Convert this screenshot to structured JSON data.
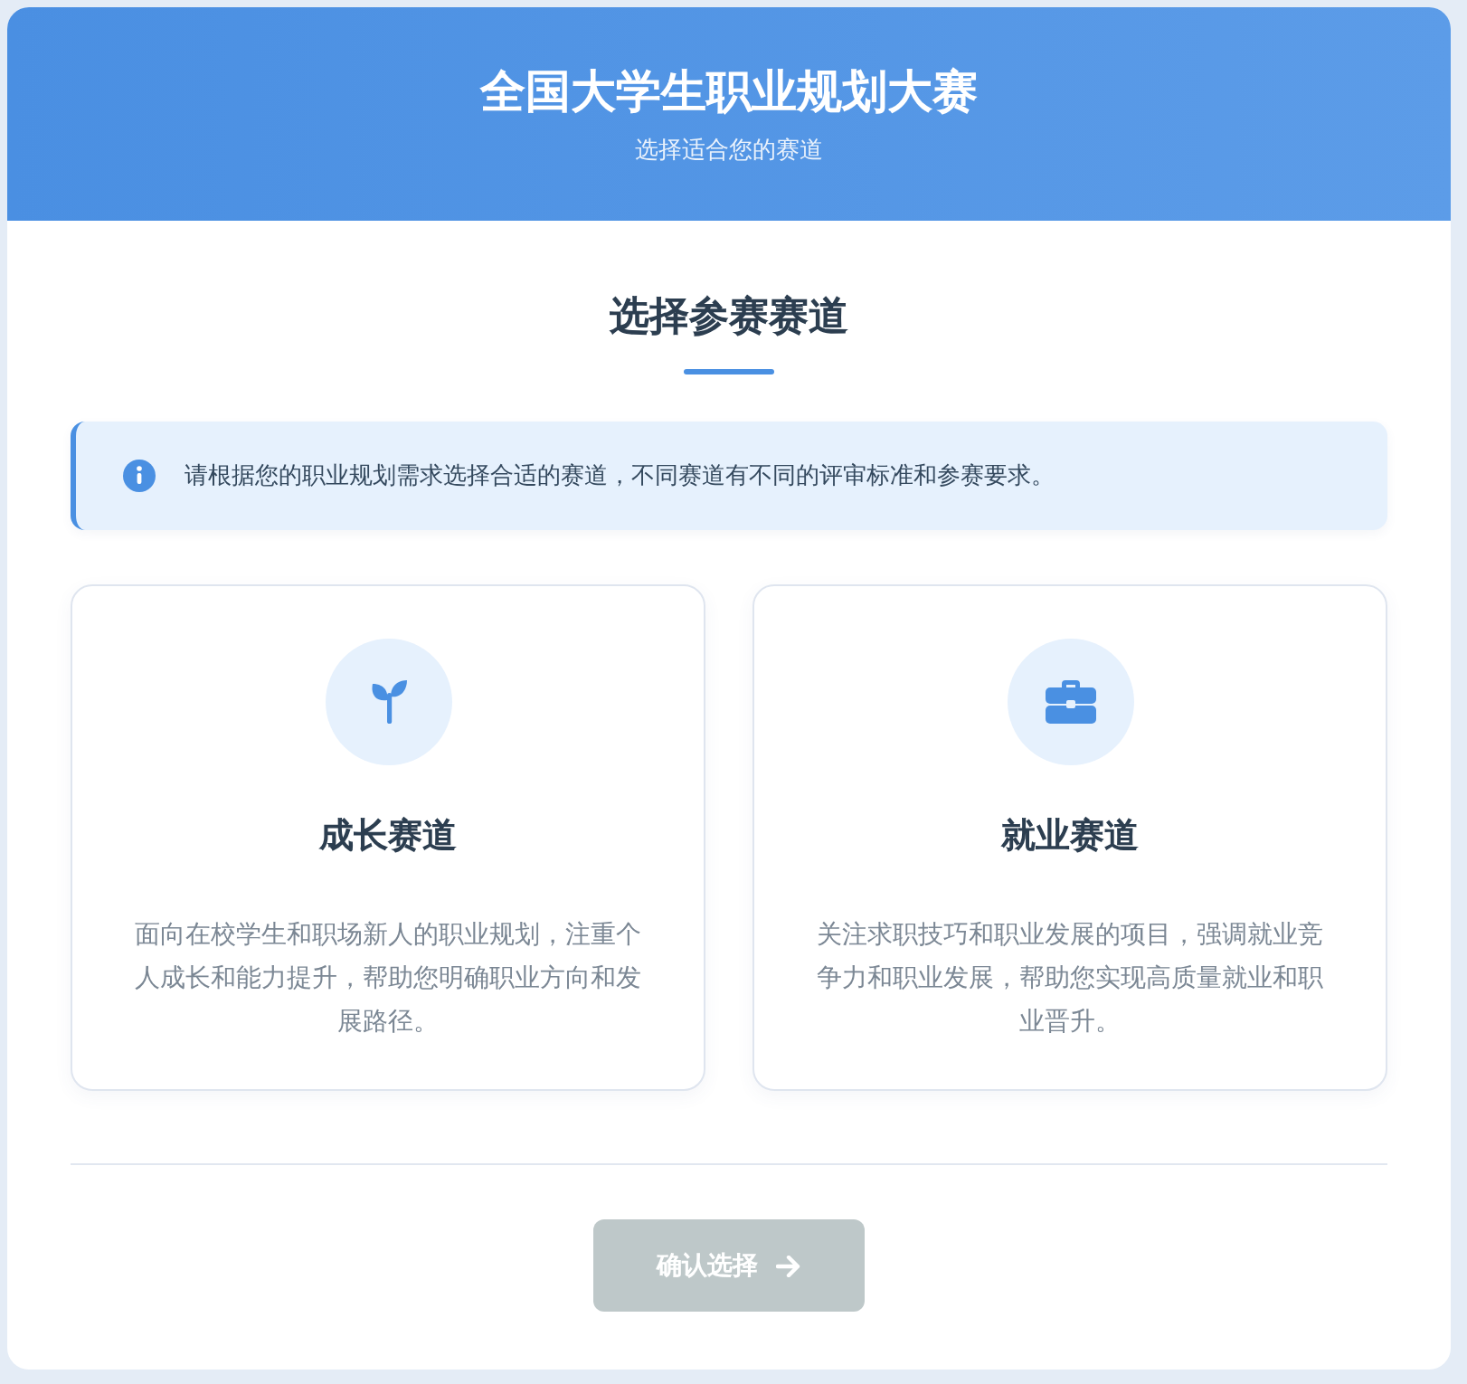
{
  "header": {
    "title": "全国大学生职业规划大赛",
    "subtitle": "选择适合您的赛道"
  },
  "section": {
    "title": "选择参赛赛道"
  },
  "notice": {
    "text": "请根据您的职业规划需求选择合适的赛道，不同赛道有不同的评审标准和参赛要求。"
  },
  "tracks": [
    {
      "kind": "seedling",
      "title": "成长赛道",
      "description": "面向在校学生和职场新人的职业规划，注重个人成长和能力提升，帮助您明确职业方向和发展路径。",
      "selected": false
    },
    {
      "kind": "briefcase",
      "title": "就业赛道",
      "description": "关注求职技巧和职业发展的项目，强调就业竞争力和职业发展，帮助您实现高质量就业和职业晋升。",
      "selected": false
    }
  ],
  "confirm_button": {
    "label": "确认选择",
    "disabled": true
  }
}
